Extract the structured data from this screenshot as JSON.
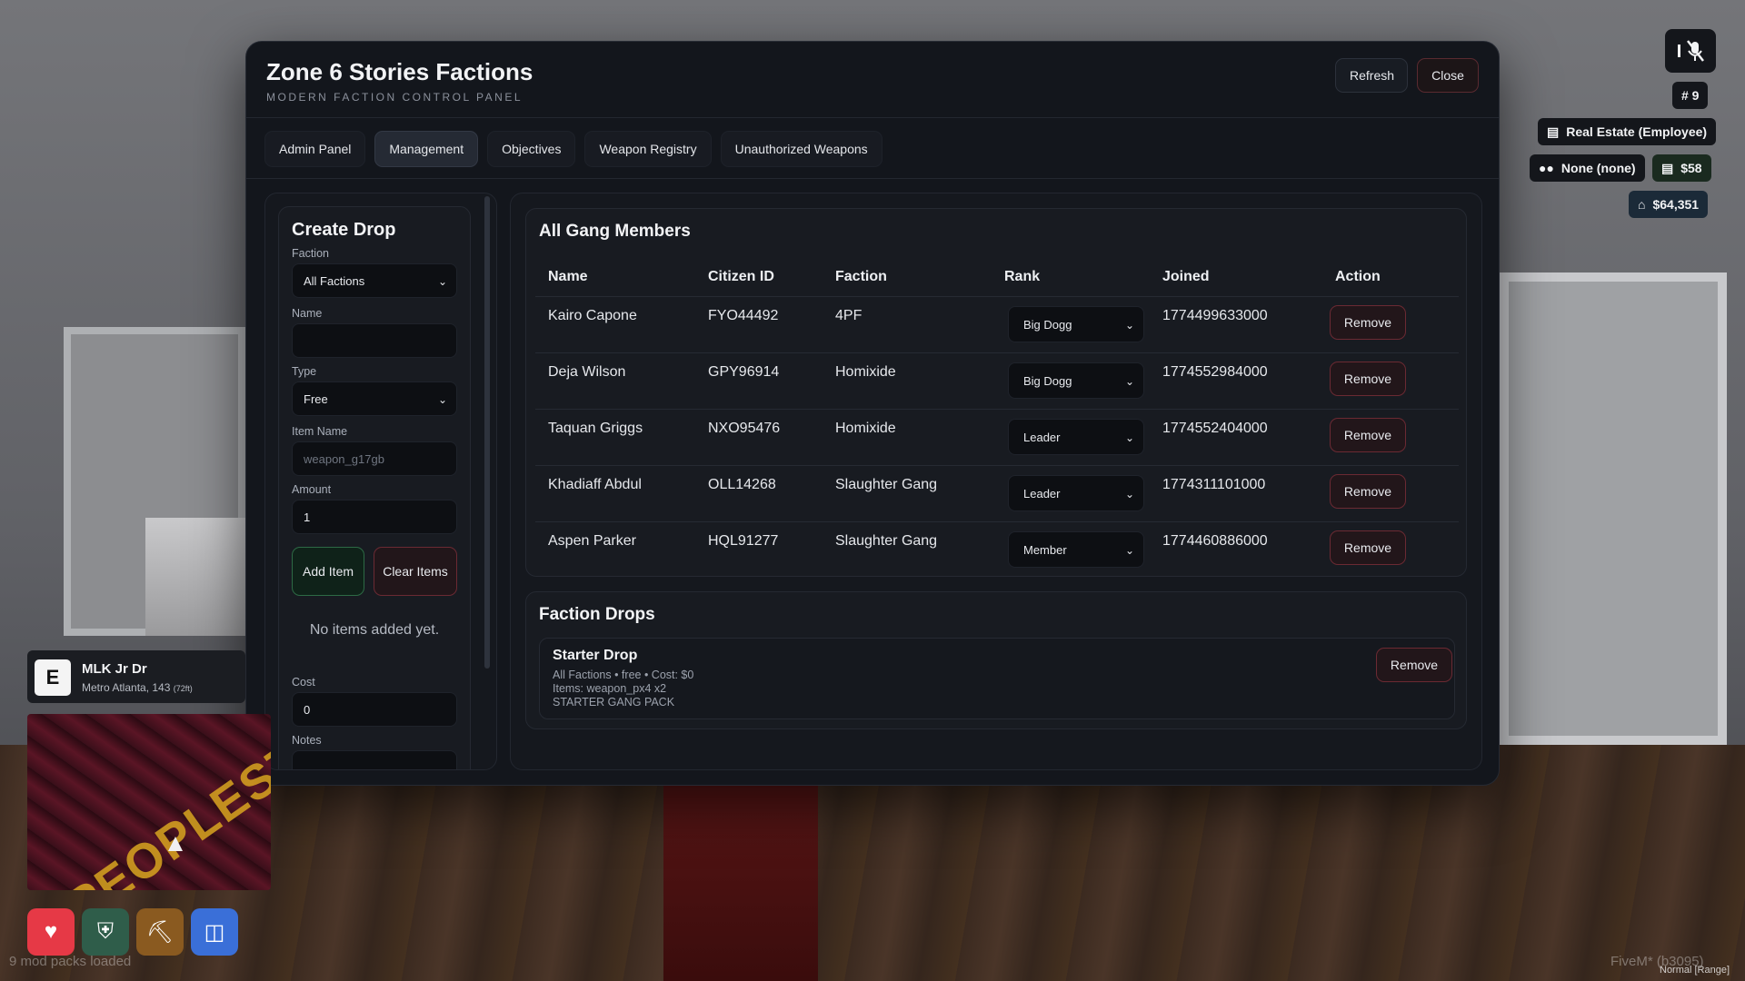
{
  "modal": {
    "title": "Zone 6 Stories Factions",
    "subtitle": "MODERN FACTION CONTROL PANEL",
    "refresh_label": "Refresh",
    "close_label": "Close"
  },
  "tabs": [
    {
      "label": "Admin Panel",
      "active": false
    },
    {
      "label": "Management",
      "active": true
    },
    {
      "label": "Objectives",
      "active": false
    },
    {
      "label": "Weapon Registry",
      "active": false
    },
    {
      "label": "Unauthorized Weapons",
      "active": false
    }
  ],
  "create_drop": {
    "title": "Create Drop",
    "faction_label": "Faction",
    "faction_value": "All Factions",
    "name_label": "Name",
    "name_value": "",
    "type_label": "Type",
    "type_value": "Free",
    "item_name_label": "Item Name",
    "item_name_placeholder": "weapon_g17gb",
    "amount_label": "Amount",
    "amount_value": "1",
    "add_item_label": "Add Item",
    "clear_items_label": "Clear Items",
    "empty_text": "No items added yet.",
    "cost_label": "Cost",
    "cost_value": "0",
    "notes_label": "Notes",
    "notes_value": ""
  },
  "members": {
    "title": "All Gang Members",
    "headers": {
      "name": "Name",
      "citizen_id": "Citizen ID",
      "faction": "Faction",
      "rank": "Rank",
      "joined": "Joined",
      "action": "Action"
    },
    "remove_label": "Remove",
    "rows": [
      {
        "name": "Kairo Capone",
        "citizen_id": "FYO44492",
        "faction": "4PF",
        "rank": "Big Dogg",
        "joined": "1774499633000"
      },
      {
        "name": "Deja Wilson",
        "citizen_id": "GPY96914",
        "faction": "Homixide",
        "rank": "Big Dogg",
        "joined": "1774552984000"
      },
      {
        "name": "Taquan Griggs",
        "citizen_id": "NXO95476",
        "faction": "Homixide",
        "rank": "Leader",
        "joined": "1774552404000"
      },
      {
        "name": "Khadiaff Abdul",
        "citizen_id": "OLL14268",
        "faction": "Slaughter Gang",
        "rank": "Leader",
        "joined": "1774311101000"
      },
      {
        "name": "Aspen Parker",
        "citizen_id": "HQL91277",
        "faction": "Slaughter Gang",
        "rank": "Member",
        "joined": "1774460886000"
      }
    ]
  },
  "drops": {
    "title": "Faction Drops",
    "items": [
      {
        "name": "Starter Drop",
        "meta": "All Factions • free • Cost: $0",
        "items_text": "Items: weapon_px4 x2",
        "notes": "STARTER GANG PACK",
        "remove_label": "Remove"
      }
    ]
  },
  "hud": {
    "player_id": "# 9",
    "job": "Real Estate (Employee)",
    "gang": "None (none)",
    "cash": "$58",
    "bank": "$64,351",
    "street_letter": "E",
    "street_name": "MLK Jr Dr",
    "street_sub": "Metro Atlanta, 143",
    "street_sub_small": "(72ft)",
    "minimap_label": "PEOPLESTOWN",
    "mod_packs": "9 mod packs loaded",
    "fivem": "FiveM* (b3095)",
    "voice_mode": "Normal [Range]"
  },
  "colors": {
    "panel_bg": "#13161c",
    "danger_border": "#6b2a33",
    "success_border": "#2d6a45",
    "health": "#e63946",
    "armor": "#2f5d4a",
    "hunger": "#8a5a20",
    "thirst": "#3a6fd8"
  }
}
